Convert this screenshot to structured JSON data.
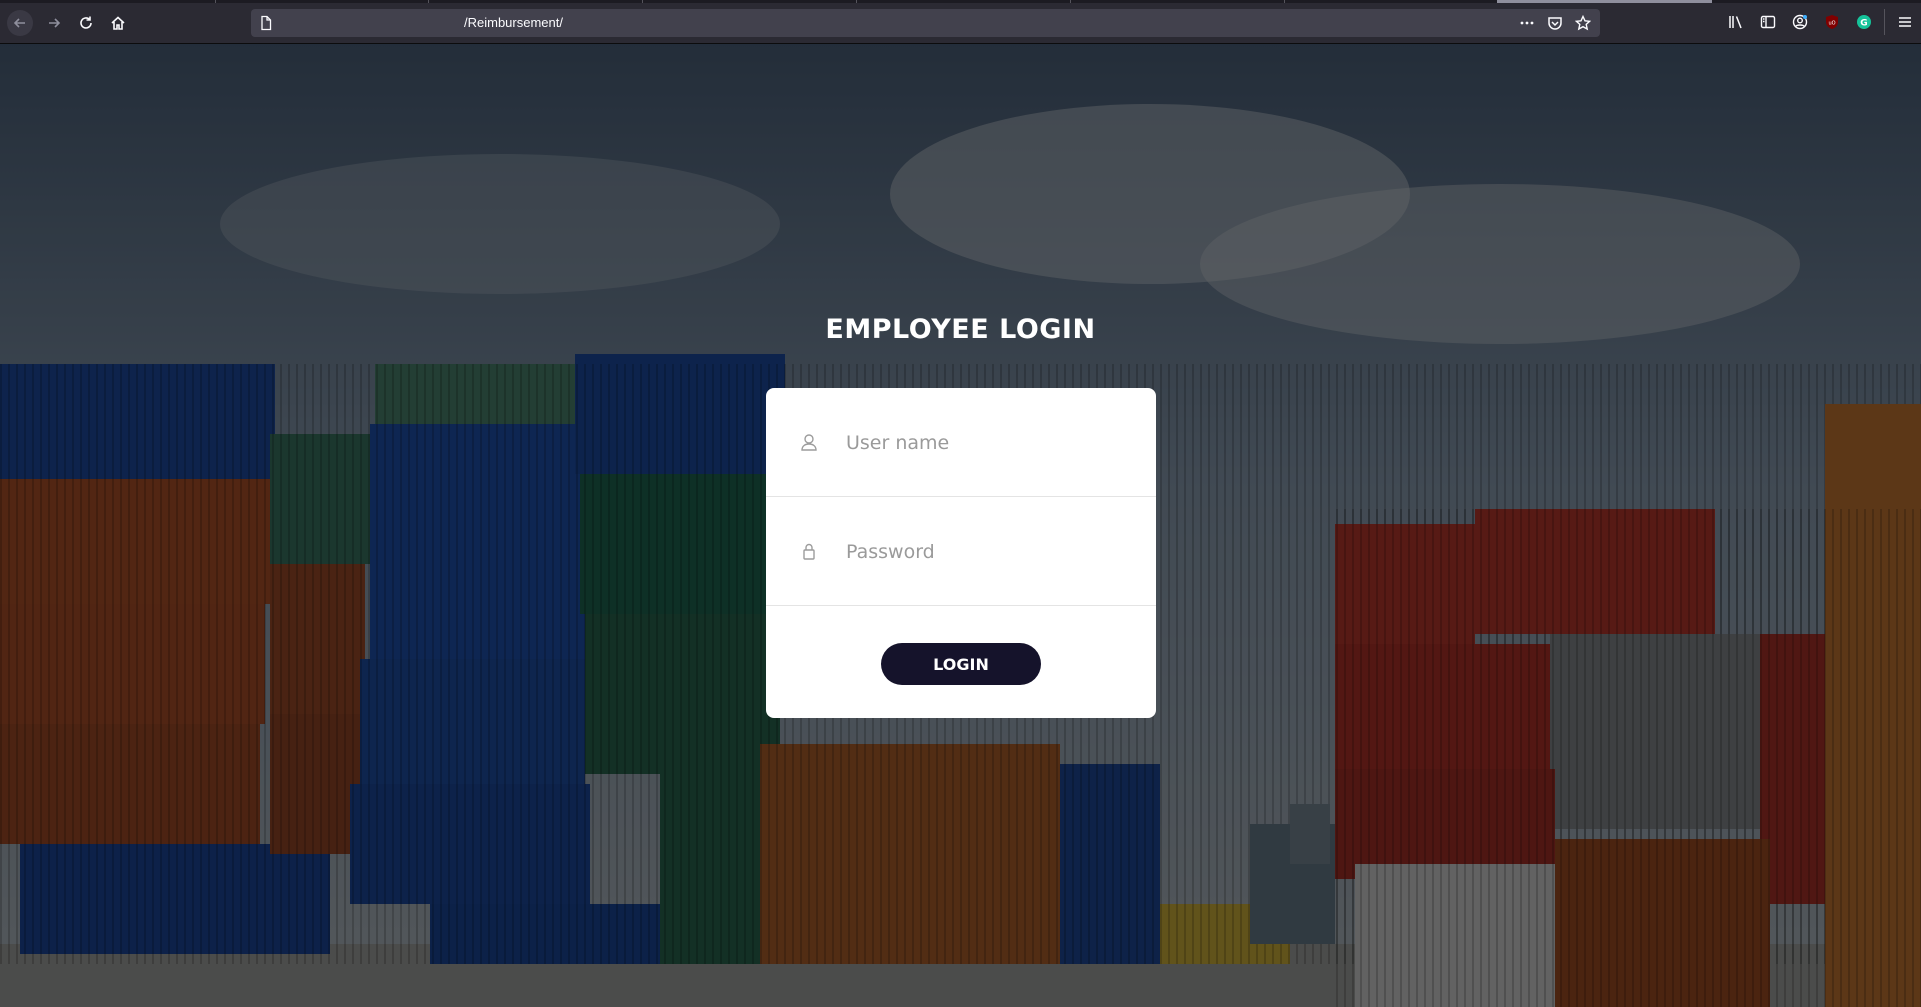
{
  "browser": {
    "url": "/Reimbursement/",
    "icons": {
      "back": "back-arrow-icon",
      "forward": "forward-arrow-icon",
      "reload": "reload-icon",
      "home": "home-icon",
      "page": "page-icon",
      "more": "more-dots-icon",
      "pocket": "pocket-icon",
      "bookmark": "star-icon",
      "library": "library-icon",
      "sidebar": "sidebar-icon",
      "account": "account-icon",
      "ublock": "ublock-icon",
      "grammarly": "grammarly-icon",
      "menu": "hamburger-menu-icon"
    }
  },
  "login": {
    "title": "EMPLOYEE LOGIN",
    "username_placeholder": "User name",
    "password_placeholder": "Password",
    "button_label": "LOGIN"
  },
  "colors": {
    "button_bg": "#15132b",
    "card_bg": "#ffffff",
    "title_color": "#ffffff"
  }
}
